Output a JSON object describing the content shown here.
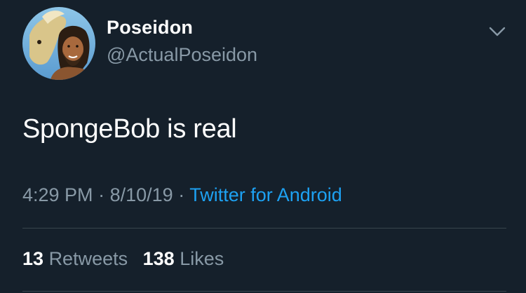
{
  "user": {
    "display_name": "Poseidon",
    "handle": "@ActualPoseidon"
  },
  "tweet": {
    "text": "SpongeBob is real",
    "time": "4:29 PM",
    "separator": "·",
    "date": "8/10/19",
    "source": "Twitter for Android"
  },
  "stats": {
    "retweets_count": "13",
    "retweets_label": "Retweets",
    "likes_count": "138",
    "likes_label": "Likes"
  },
  "icons": {
    "menu": "chevron-down-icon"
  },
  "colors": {
    "background": "#15202b",
    "primary_text": "#ffffff",
    "secondary_text": "#8899a6",
    "link": "#1da1f2",
    "divider": "#38444d"
  }
}
